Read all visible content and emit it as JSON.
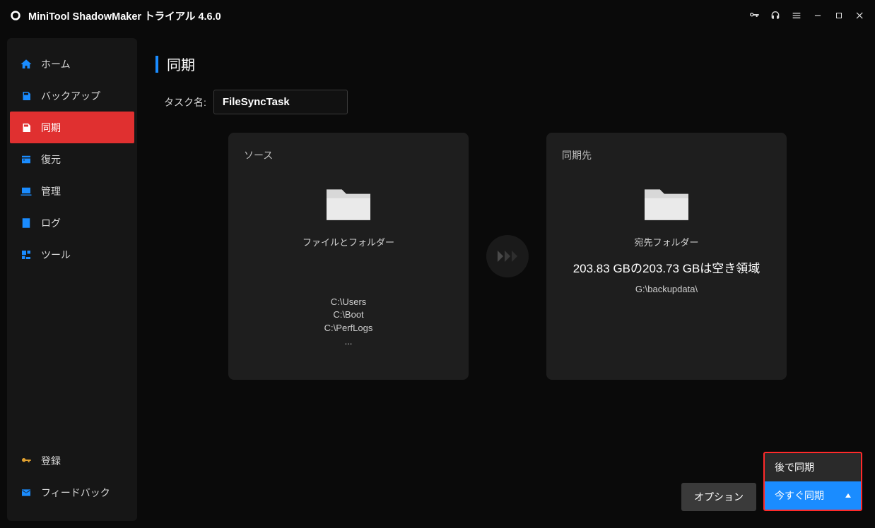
{
  "app": {
    "title": "MiniTool ShadowMaker トライアル 4.6.0"
  },
  "sidebar": {
    "items": [
      {
        "label": "ホーム"
      },
      {
        "label": "バックアップ"
      },
      {
        "label": "同期"
      },
      {
        "label": "復元"
      },
      {
        "label": "管理"
      },
      {
        "label": "ログ"
      },
      {
        "label": "ツール"
      }
    ],
    "register": "登録",
    "feedback": "フィードバック"
  },
  "page": {
    "title": "同期",
    "task_name_label": "タスク名:",
    "task_name_value": "FileSyncTask",
    "source": {
      "label": "ソース",
      "sub": "ファイルとフォルダー",
      "paths": "C:\\Users\nC:\\Boot\nC:\\PerfLogs\n..."
    },
    "destination": {
      "label": "同期先",
      "sub": "宛先フォルダー",
      "info": "203.83 GBの203.73 GBは空き領域",
      "path": "G:\\backupdata\\"
    },
    "options_button": "オプション",
    "sync_menu": {
      "later": "後で同期",
      "now": "今すぐ同期"
    }
  }
}
